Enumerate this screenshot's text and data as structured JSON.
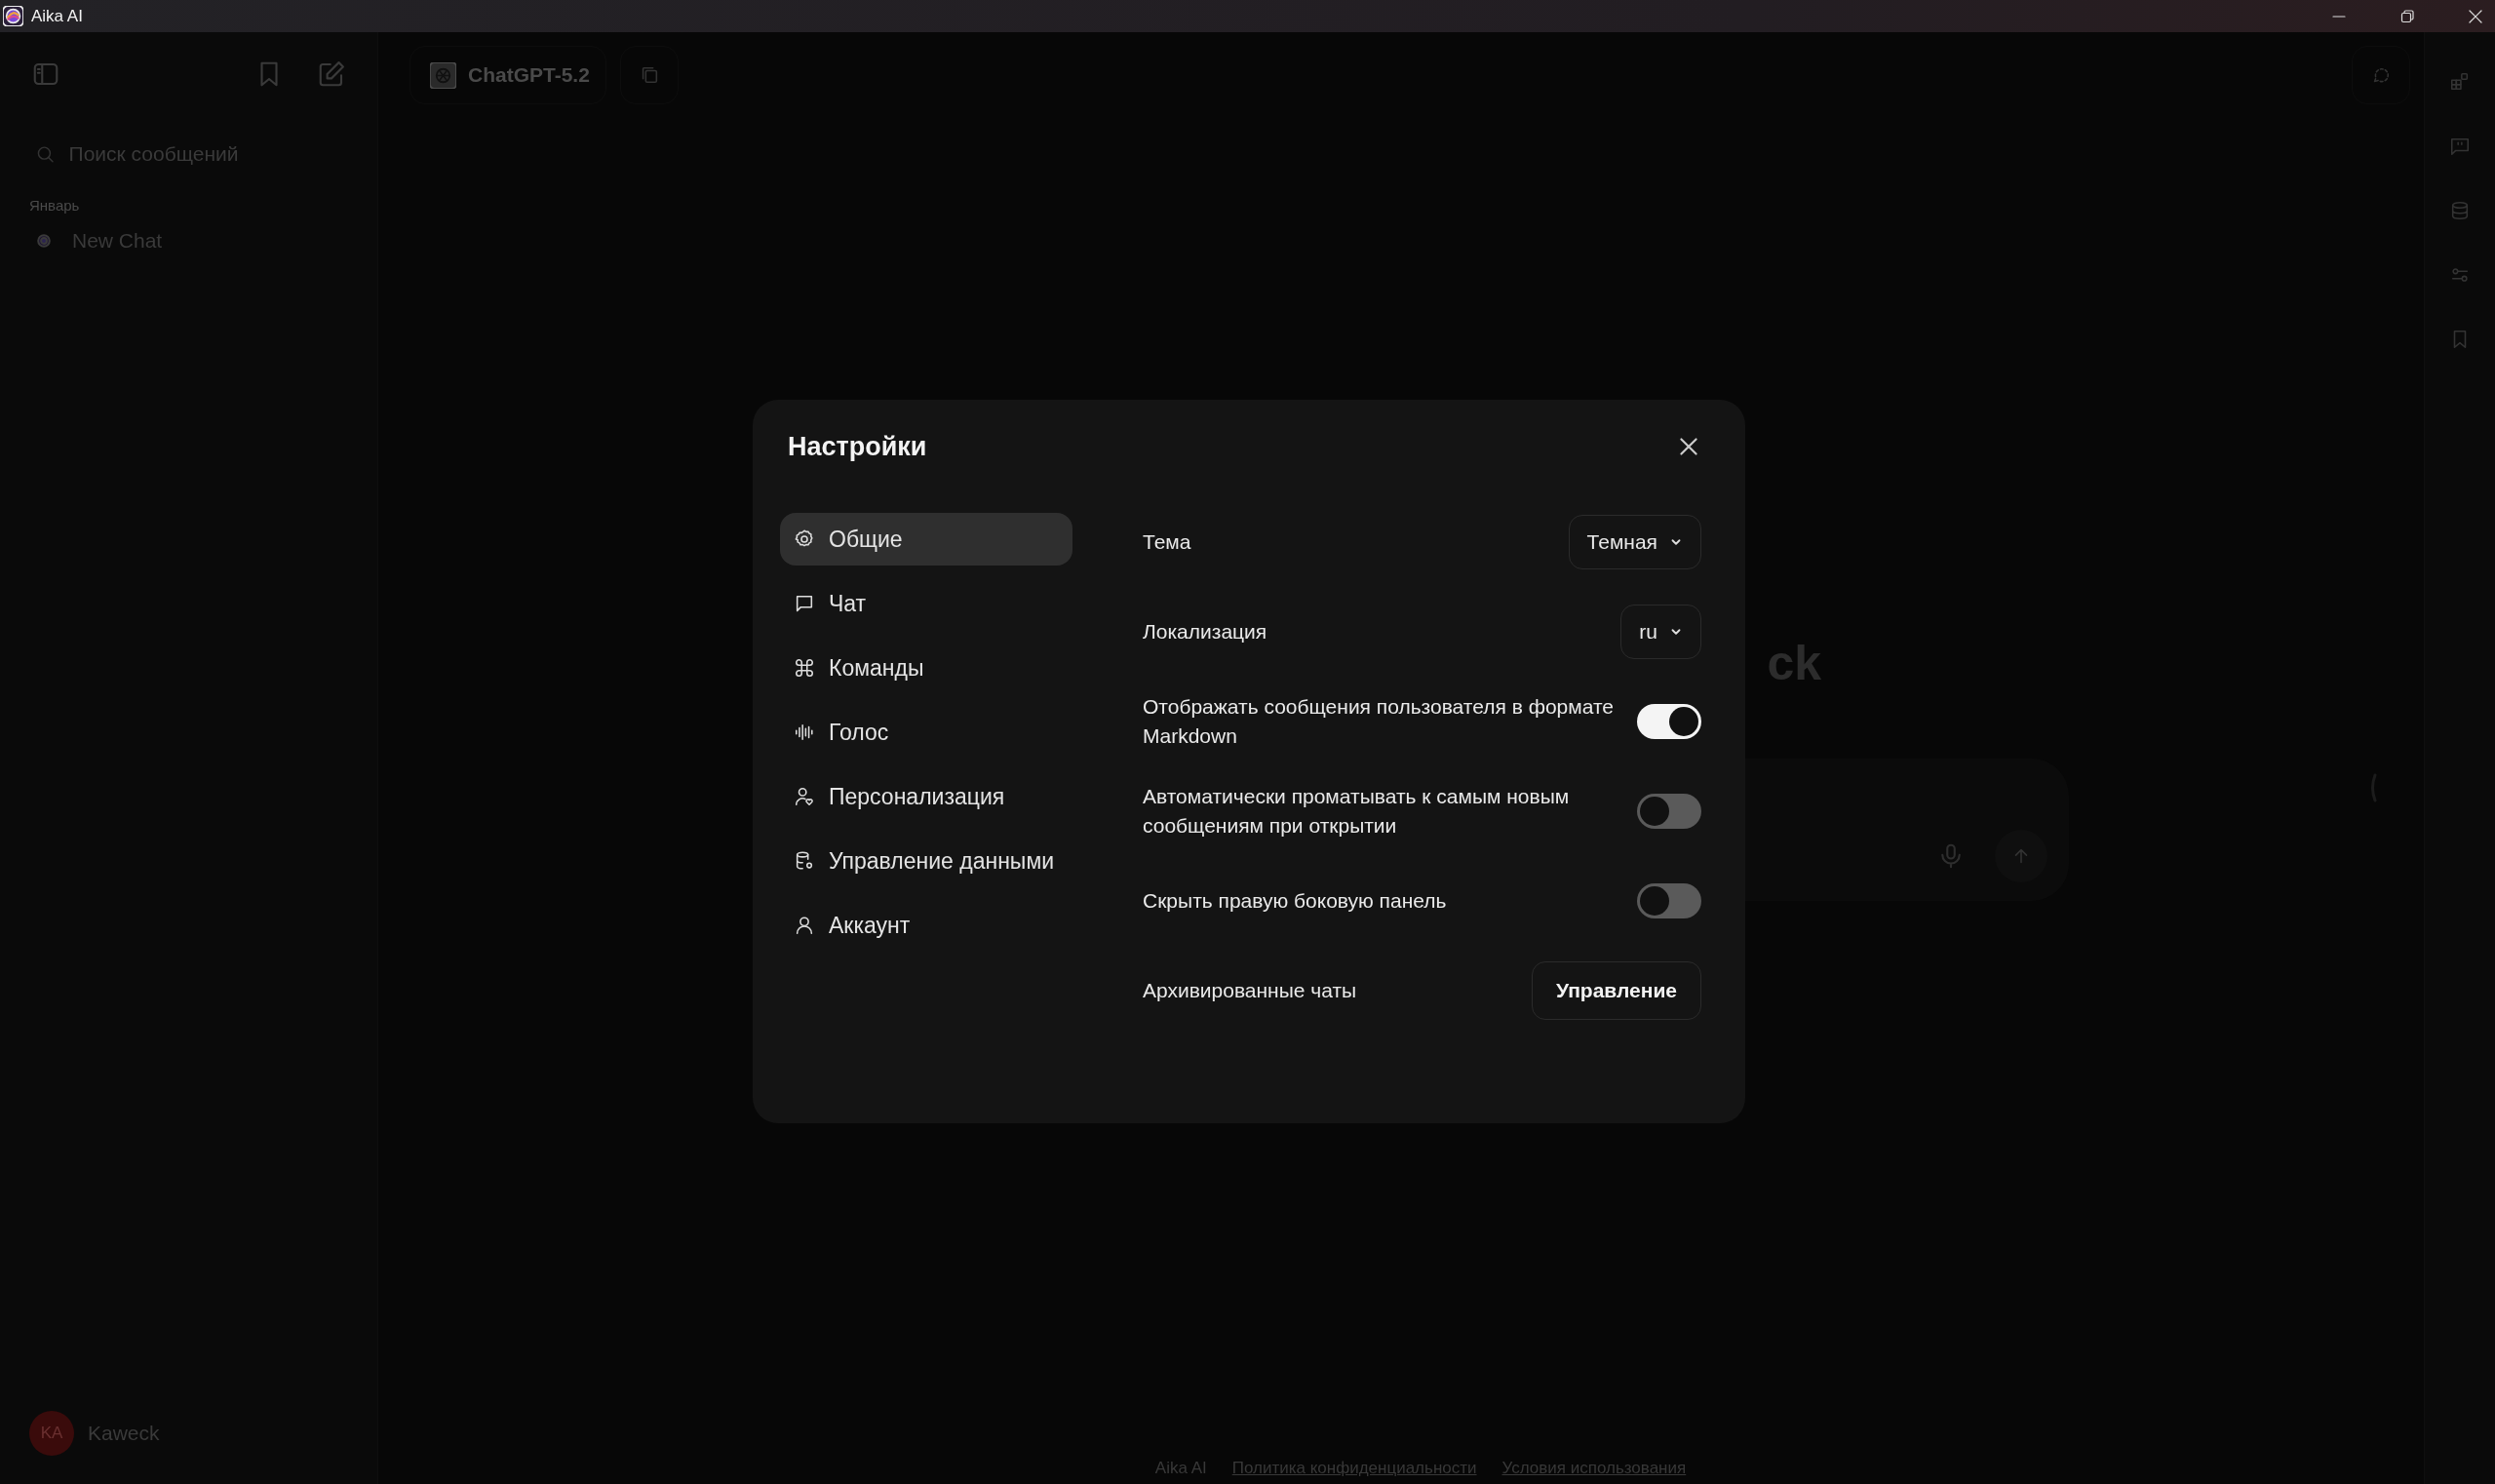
{
  "window": {
    "title": "Aika AI"
  },
  "sidebar": {
    "search": {
      "placeholder": "Поиск сообщений"
    },
    "group_label": "Январь",
    "chats": [
      {
        "title": "New Chat"
      }
    ],
    "user": {
      "initials": "KA",
      "name": "Kaweck"
    }
  },
  "header": {
    "model": "ChatGPT-5.2"
  },
  "main": {
    "heading": "ck"
  },
  "footer": {
    "brand": "Aika AI",
    "links": [
      "Политика конфиденциальности",
      "Условия использования"
    ]
  },
  "settings": {
    "title": "Настройки",
    "nav": [
      {
        "label": "Общие",
        "selected": true
      },
      {
        "label": "Чат",
        "selected": false
      },
      {
        "label": "Команды",
        "selected": false
      },
      {
        "label": "Голос",
        "selected": false
      },
      {
        "label": "Персонализация",
        "selected": false
      },
      {
        "label": "Управление данными",
        "selected": false
      },
      {
        "label": "Аккаунт",
        "selected": false
      }
    ],
    "rows": [
      {
        "kind": "select",
        "label": "Тема",
        "value": "Темная"
      },
      {
        "kind": "select",
        "label": "Локализация",
        "value": "ru"
      },
      {
        "kind": "toggle",
        "label": "Отображать сообщения пользователя в формате Markdown",
        "on": true
      },
      {
        "kind": "toggle",
        "label": "Автоматически проматывать к самым новым сообщениям при открытии",
        "on": false
      },
      {
        "kind": "toggle",
        "label": "Скрыть правую боковую панель",
        "on": false
      },
      {
        "kind": "button",
        "label": "Архивированные чаты",
        "button": "Управление"
      }
    ]
  }
}
